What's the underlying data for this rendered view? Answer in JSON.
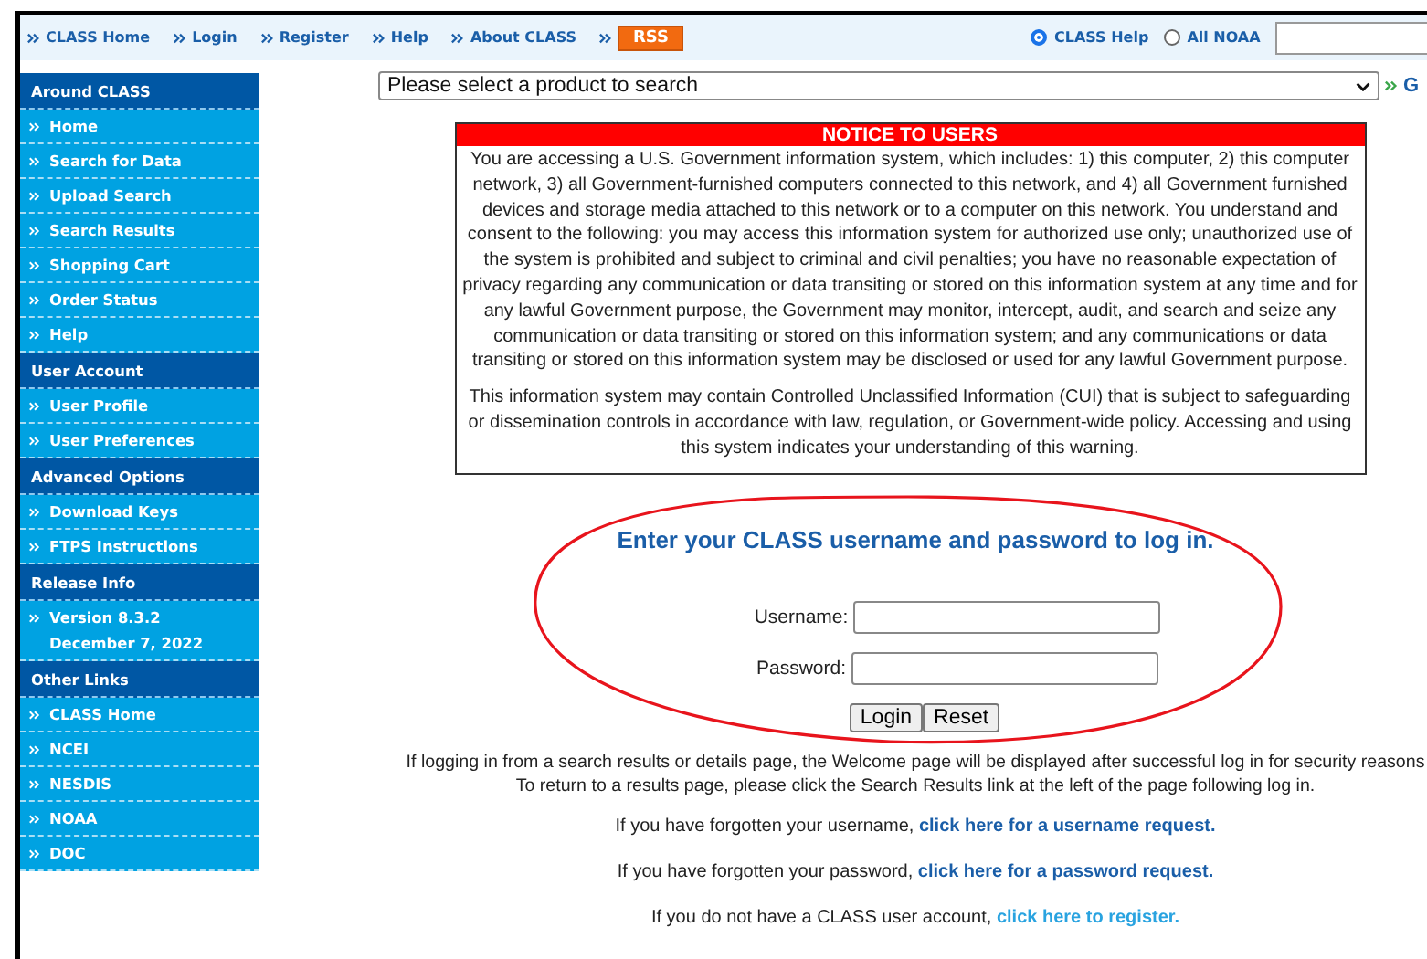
{
  "top_nav": {
    "links": [
      {
        "label": "CLASS Home"
      },
      {
        "label": "Login"
      },
      {
        "label": "Register"
      },
      {
        "label": "Help"
      },
      {
        "label": "About CLASS"
      }
    ],
    "rss": "RSS",
    "search_scope": [
      {
        "label": "CLASS Help",
        "selected": true
      },
      {
        "label": "All NOAA",
        "selected": false
      }
    ]
  },
  "product_select": {
    "value": "Please select a product to search",
    "go": "G"
  },
  "sidebar": [
    {
      "title": "Around CLASS",
      "items": [
        {
          "lines": [
            "Home"
          ]
        },
        {
          "lines": [
            "Search for Data"
          ]
        },
        {
          "lines": [
            "Upload Search"
          ]
        },
        {
          "lines": [
            "Search Results"
          ]
        },
        {
          "lines": [
            "Shopping Cart"
          ]
        },
        {
          "lines": [
            "Order Status"
          ]
        },
        {
          "lines": [
            "Help"
          ]
        }
      ]
    },
    {
      "title": "User Account",
      "items": [
        {
          "lines": [
            "User Profile"
          ]
        },
        {
          "lines": [
            "User Preferences"
          ]
        }
      ]
    },
    {
      "title": "Advanced Options",
      "items": [
        {
          "lines": [
            "Download Keys"
          ]
        },
        {
          "lines": [
            "FTPS Instructions"
          ]
        }
      ]
    },
    {
      "title": "Release Info",
      "items": [
        {
          "lines": [
            "Version 8.3.2",
            "December 7, 2022"
          ]
        }
      ]
    },
    {
      "title": "Other Links",
      "items": [
        {
          "lines": [
            "CLASS Home"
          ]
        },
        {
          "lines": [
            "NCEI"
          ]
        },
        {
          "lines": [
            "NESDIS"
          ]
        },
        {
          "lines": [
            "NOAA"
          ]
        },
        {
          "lines": [
            "DOC"
          ]
        }
      ]
    }
  ],
  "notice": {
    "title": "NOTICE TO USERS",
    "paragraphs": [
      "You are accessing a U.S. Government information system, which includes: 1) this computer, 2) this computer network, 3) all Government-furnished computers connected to this network, and 4) all Government furnished devices and storage media attached to this network or to a computer on this network. You understand and consent to the following: you may access this information system for authorized use only; unauthorized use of the system is prohibited and subject to criminal and civil penalties; you have no reasonable expectation of privacy regarding any communication or data transiting or stored on this information system at any time and for any lawful Government purpose, the Government may monitor, intercept, audit, and search and seize any communication or data transiting or stored on this information system; and any communications or data transiting or stored on this information system may be disclosed or used for any lawful Government purpose.",
      "This information system may contain Controlled Unclassified Information (CUI) that is subject to safeguarding or dissemination controls in accordance with law, regulation, or Government-wide policy. Accessing and using this system indicates your understanding of this warning."
    ]
  },
  "login": {
    "heading": "Enter your CLASS username and password to log in.",
    "fields": [
      {
        "label": "Username:"
      },
      {
        "label": "Password:"
      }
    ],
    "buttons": [
      "Login",
      "Reset"
    ]
  },
  "info_lines": [
    "If logging in from a search results or details page, the Welcome page will be displayed after successful log in for security reasons",
    "To return to a results page, please click the Search Results link at the left of the page following log in."
  ],
  "help_lines": [
    {
      "text": "If you have forgotten your username,",
      "link": "click here for a username request.",
      "color": "#1a5ea8"
    },
    {
      "text": "If you have forgotten your password,",
      "link": "click here for a password request.",
      "color": "#1a5ea8"
    },
    {
      "text": "If you do not have a CLASS user account,",
      "link": "click here to register.",
      "color": "#29a3e0"
    }
  ]
}
